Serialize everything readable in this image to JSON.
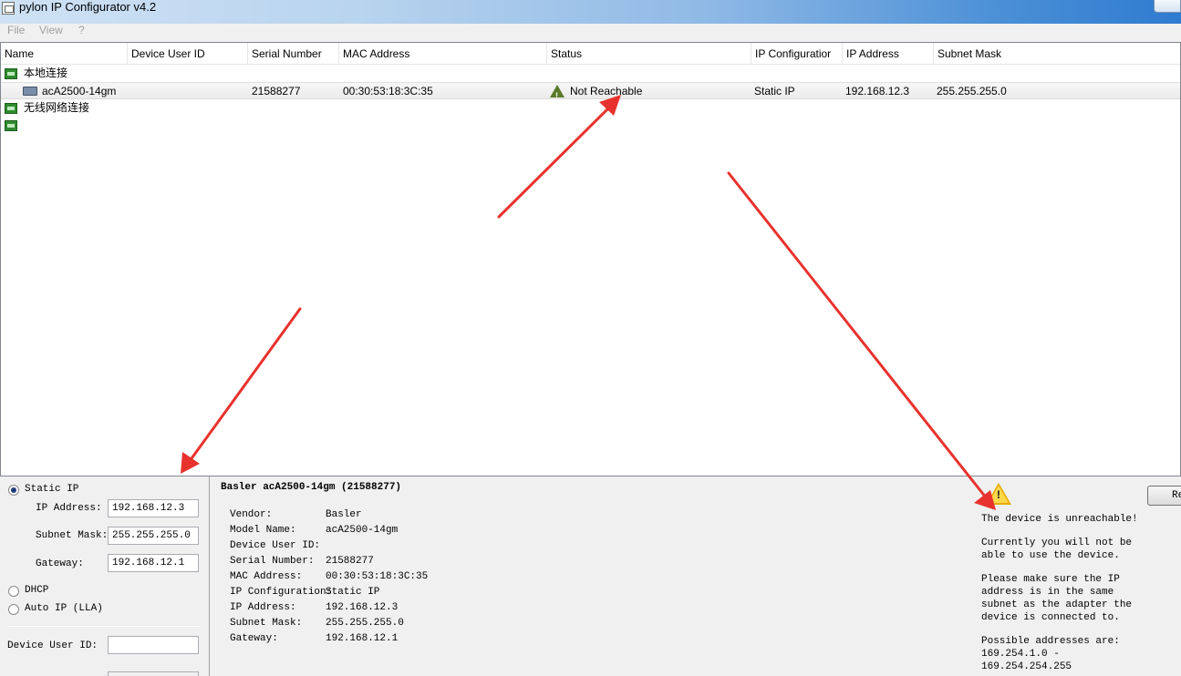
{
  "window": {
    "title": "pylon IP Configurator v4.2"
  },
  "menu": {
    "items": [
      "File",
      "View",
      "?"
    ]
  },
  "device_list": {
    "columns": [
      "Name",
      "Device User ID",
      "Serial Number",
      "MAC Address",
      "Status",
      "IP Configuratior",
      "IP Address",
      "Subnet Mask"
    ],
    "adapters": [
      {
        "name": "本地连接"
      },
      {
        "name": "无线网络连接"
      },
      {
        "name": ""
      }
    ],
    "device": {
      "name": "acA2500-14gm",
      "user_id": "",
      "serial": "21588277",
      "mac": "00:30:53:18:3C:35",
      "status": "Not Reachable",
      "ip_config": "Static IP",
      "ip": "192.168.12.3",
      "subnet": "255.255.255.0"
    }
  },
  "config_panel": {
    "static_ip_label": "Static IP",
    "ip_label": "IP Address:",
    "ip_value": "192.168.12.3",
    "subnet_label": "Subnet Mask:",
    "subnet_value": "255.255.255.0",
    "gateway_label": "Gateway:",
    "gateway_value": "192.168.12.1",
    "dhcp_label": "DHCP",
    "autoip_label": "Auto IP (LLA)",
    "user_id_label": "Device User ID:",
    "user_id_value": ""
  },
  "info_panel": {
    "title": "Basler acA2500-14gm (21588277)",
    "rows": [
      {
        "label": "Vendor:",
        "value": "Basler"
      },
      {
        "label": "Model Name:",
        "value": "acA2500-14gm"
      },
      {
        "label": "Device User ID:",
        "value": ""
      },
      {
        "label": "Serial Number:",
        "value": "21588277"
      },
      {
        "label": "MAC Address:",
        "value": "00:30:53:18:3C:35"
      },
      {
        "label": "IP Configuration:",
        "value": "Static IP"
      },
      {
        "label": "IP Address:",
        "value": "192.168.12.3"
      },
      {
        "label": "Subnet Mask:",
        "value": "255.255.255.0"
      },
      {
        "label": "Gateway:",
        "value": "192.168.12.1"
      }
    ]
  },
  "warning_panel": {
    "line1": "The device is unreachable!",
    "line2a": "Currently you will not be",
    "line2b": "able to use the device.",
    "line3a": "Please make sure the IP",
    "line3b": "address is in the same",
    "line3c": "subnet as the adapter the",
    "line3d": "device is connected to.",
    "line4a": "Possible addresses are:",
    "line4b": "169.254.1.0 -",
    "line4c": "169.254.254.255",
    "button_label": "Re"
  },
  "colors": {
    "arrow": "#e8322d",
    "status_warning": "#5a7a2a"
  }
}
